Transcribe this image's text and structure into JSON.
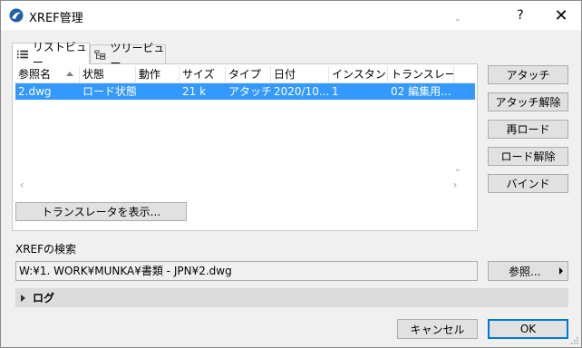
{
  "window": {
    "title": "XREF管理",
    "help_label": "?",
    "close_label": "✕"
  },
  "tabs": [
    {
      "label": "リストビュー",
      "active": true
    },
    {
      "label": "ツリービュー",
      "active": false
    }
  ],
  "table": {
    "columns": [
      "参照名",
      "状態",
      "動作",
      "サイズ",
      "タイプ",
      "日付",
      "インスタンス",
      "トランスレータ"
    ],
    "rows": [
      [
        "2.dwg",
        "ロード状態",
        "",
        "21 k",
        "アタッチ",
        "2020/10...",
        "1",
        "02 編集用..."
      ]
    ]
  },
  "show_translator_label": "トランスレータを表示...",
  "side_buttons": [
    "アタッチ",
    "アタッチ解除",
    "再ロード",
    "ロード解除",
    "バインド"
  ],
  "search": {
    "label": "XREFの検索",
    "path": "W:¥1. WORK¥MUNKA¥書類 - JPN¥2.dwg",
    "browse_label": "参照..."
  },
  "log": {
    "label": "ログ"
  },
  "footer": {
    "cancel_label": "キャンセル",
    "ok_label": "OK"
  },
  "colors": {
    "selection": "#3399ff",
    "default_button_border": "#0078d7"
  }
}
